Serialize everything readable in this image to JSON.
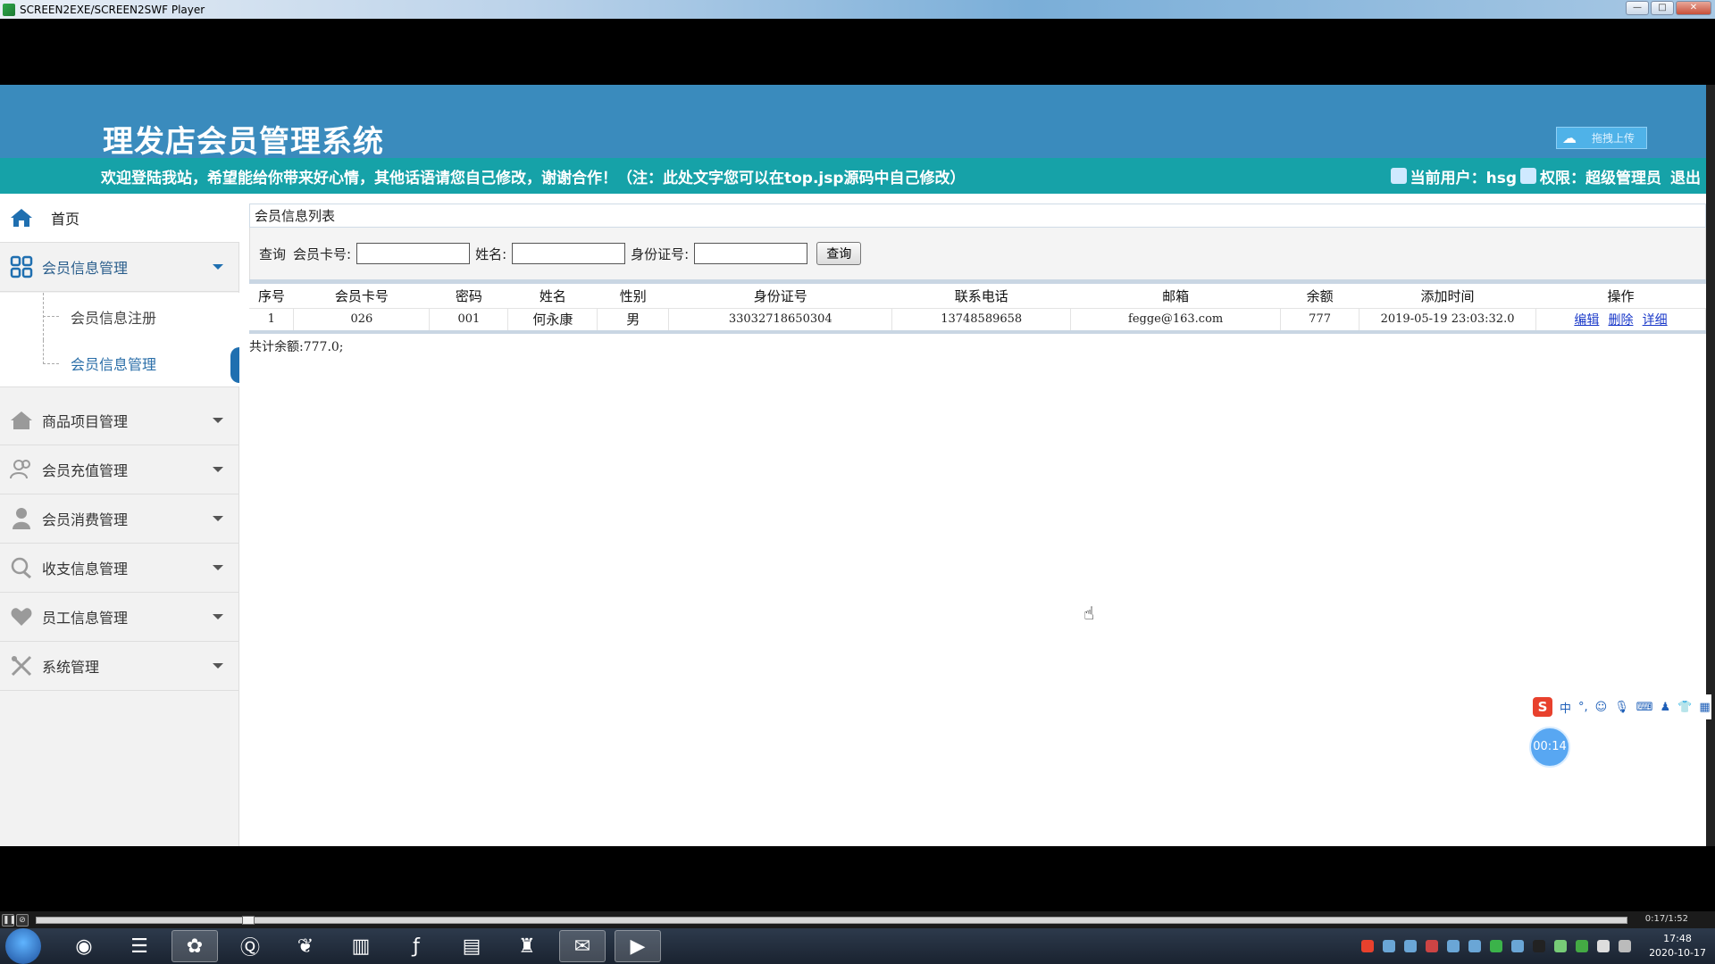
{
  "window": {
    "title": "SCREEN2EXE/SCREEN2SWF Player",
    "minimize": "—",
    "maximize": "□",
    "close": "✕"
  },
  "header": {
    "system_title": "理发店会员管理系统",
    "upload_label": "拖拽上传",
    "notice": "欢迎登陆我站，希望能给你带来好心情，其他话语请您自己修改，谢谢合作！（注：此处文字您可以在top.jsp源码中自己修改）",
    "current_user_label": "当前用户：hsg",
    "role_label": "权限：超级管理员",
    "logout_label": "退出"
  },
  "sidebar": {
    "home": "首页",
    "groups": [
      {
        "label": "会员信息管理",
        "icon": "grid-icon"
      },
      {
        "label": "商品项目管理",
        "icon": "house-icon"
      },
      {
        "label": "会员充值管理",
        "icon": "users-icon"
      },
      {
        "label": "会员消费管理",
        "icon": "user-icon"
      },
      {
        "label": "收支信息管理",
        "icon": "chat-icon"
      },
      {
        "label": "员工信息管理",
        "icon": "heart-icon"
      },
      {
        "label": "系统管理",
        "icon": "tools-icon"
      }
    ],
    "subitems": [
      {
        "label": "会员信息注册"
      },
      {
        "label": "会员信息管理"
      }
    ]
  },
  "main": {
    "panel_title": "会员信息列表",
    "search": {
      "prefix": "查询",
      "card_label": "会员卡号:",
      "card_value": "",
      "name_label": "姓名:",
      "name_value": "",
      "idcard_label": "身份证号:",
      "idcard_value": "",
      "button": "查询"
    },
    "columns": [
      "序号",
      "会员卡号",
      "密码",
      "姓名",
      "性别",
      "身份证号",
      "联系电话",
      "邮箱",
      "余额",
      "添加时间",
      "操作"
    ],
    "rows": [
      {
        "index": "1",
        "card": "026",
        "password": "001",
        "name": "何永康",
        "gender": "男",
        "idcard": "33032718650304",
        "phone": "13748589658",
        "email": "fegge@163.com",
        "balance": "777",
        "added": "2019-05-19 23:03:32.0",
        "actions": [
          "编辑",
          "删除",
          "详细"
        ]
      }
    ],
    "total": "共计余额:777.0;"
  },
  "widgets": {
    "ime_logo": "S",
    "ime_mode": "中",
    "timer": "00:14"
  },
  "player": {
    "time": "0:17/1:52",
    "progress": 0.13
  },
  "taskbar": {
    "time": "17:48",
    "date": "2020-10-17"
  }
}
